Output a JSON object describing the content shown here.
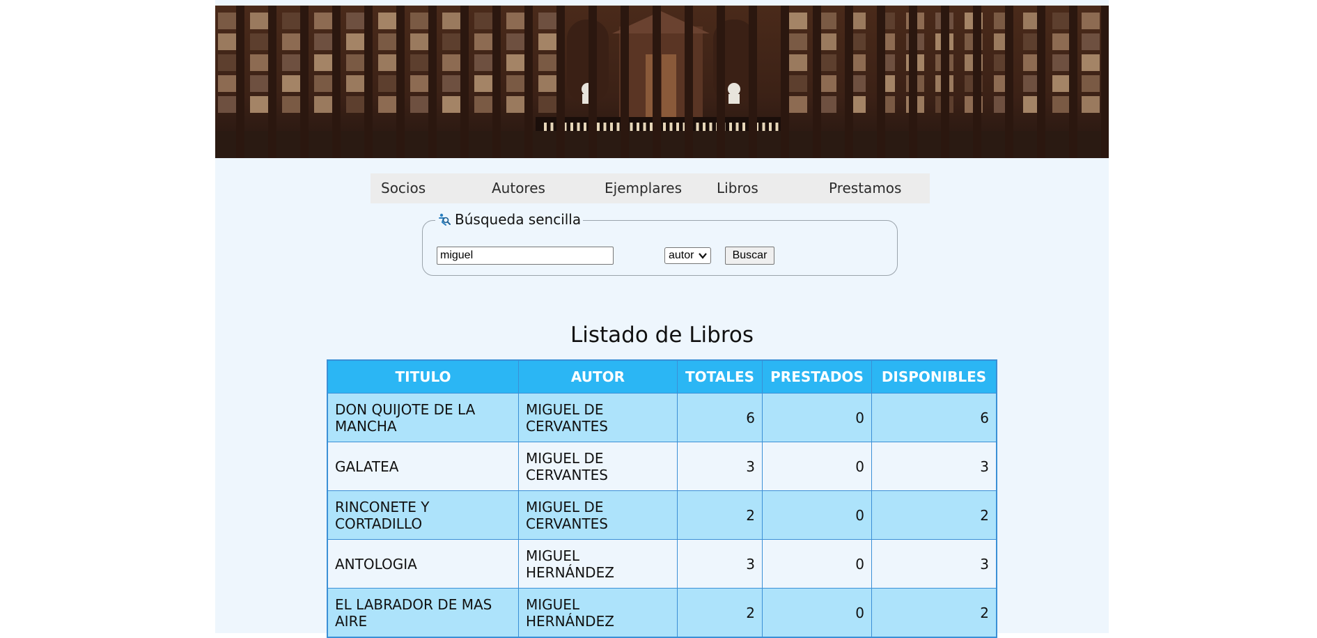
{
  "nav": {
    "items": [
      "Socios",
      "Autores",
      "Ejemplares",
      "Libros",
      "Prestamos"
    ]
  },
  "search": {
    "legend": "Búsqueda sencilla",
    "legend_icon": "search-person-icon",
    "query": "miguel",
    "field_selected": "autor",
    "button": "Buscar"
  },
  "list": {
    "title": "Listado de Libros",
    "headers": [
      "TITULO",
      "AUTOR",
      "TOTALES",
      "PRESTADOS",
      "DISPONIBLES"
    ],
    "rows": [
      {
        "titulo": "DON QUIJOTE DE LA MANCHA",
        "autor": "MIGUEL DE CERVANTES",
        "totales": "6",
        "prestados": "0",
        "disponibles": "6"
      },
      {
        "titulo": "GALATEA",
        "autor": "MIGUEL DE CERVANTES",
        "totales": "3",
        "prestados": "0",
        "disponibles": "3"
      },
      {
        "titulo": "RINCONETE Y CORTADILLO",
        "autor": "MIGUEL DE CERVANTES",
        "totales": "2",
        "prestados": "0",
        "disponibles": "2"
      },
      {
        "titulo": "ANTOLOGIA",
        "autor": "MIGUEL HERNÁNDEZ",
        "totales": "3",
        "prestados": "0",
        "disponibles": "3"
      },
      {
        "titulo": "EL LABRADOR DE MAS AIRE",
        "autor": "MIGUEL HERNÁNDEZ",
        "totales": "2",
        "prestados": "0",
        "disponibles": "2"
      }
    ]
  },
  "colors": {
    "header_bg": "#2bb6f4",
    "row_odd": "#ade3fb",
    "row_even": "#eef6fd",
    "border": "#3a8fd6",
    "page_bg": "#eef6fd"
  }
}
